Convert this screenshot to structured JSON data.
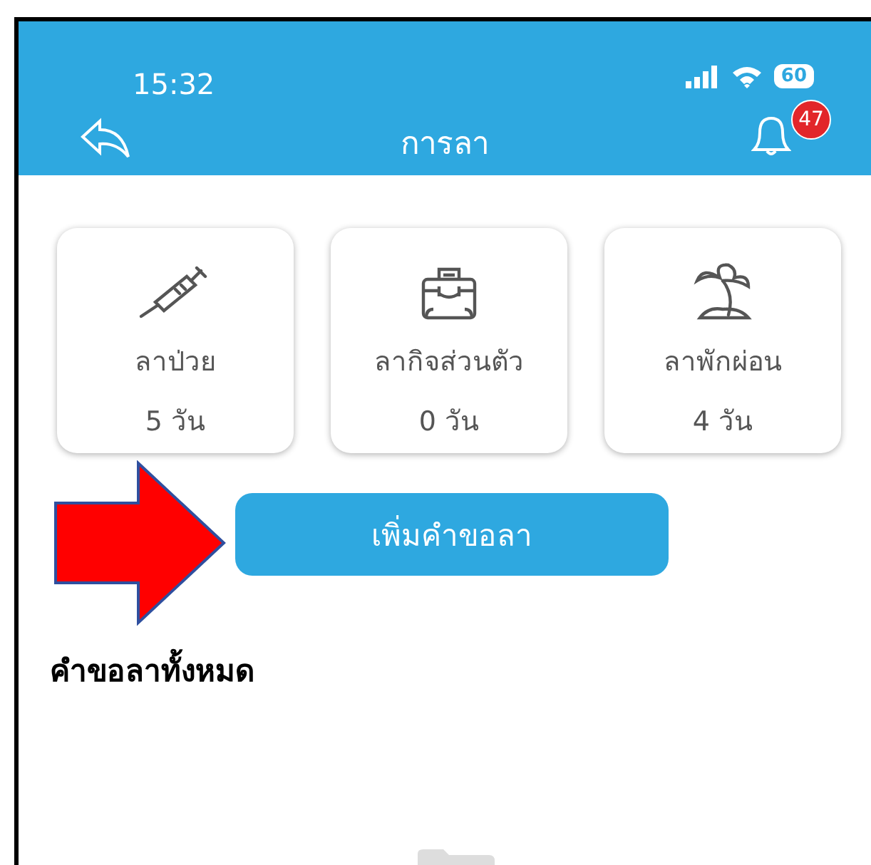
{
  "status_bar": {
    "time": "15:32",
    "battery": "60"
  },
  "header": {
    "title": "การลา",
    "notification_count": "47"
  },
  "leave_types": [
    {
      "kind": "syringe",
      "label": "ลาป่วย",
      "days": "5 วัน"
    },
    {
      "kind": "briefcase",
      "label": "ลากิจส่วนตัว",
      "days": "0 วัน"
    },
    {
      "kind": "palm",
      "label": "ลาพักผ่อน",
      "days": "4 วัน"
    }
  ],
  "add_button": "เพิ่มคำขอลา",
  "requests": {
    "title": "คำขอลาทั้งหมด"
  }
}
